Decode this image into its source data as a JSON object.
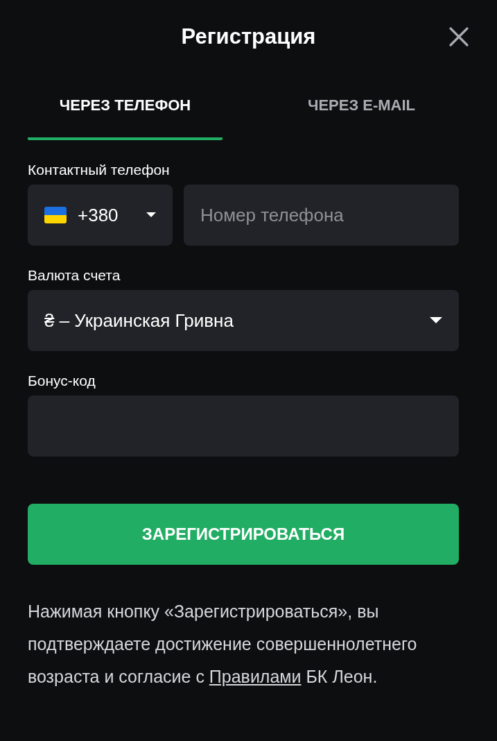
{
  "title": "Регистрация",
  "tabs": [
    {
      "label": "ЧЕРЕЗ ТЕЛЕФОН",
      "selected": true
    },
    {
      "label": "ЧЕРЕЗ E-MAIL",
      "selected": false
    }
  ],
  "phone": {
    "label": "Контактный телефон",
    "country_code": "+380",
    "placeholder": "Номер телефона"
  },
  "currency": {
    "label": "Валюта счета",
    "value": "₴ – Украинская Гривна"
  },
  "bonus_code": {
    "label": "Бонус-код"
  },
  "submit_button": "ЗАРЕГИСТРИРОВАТЬСЯ",
  "notice": {
    "text_before": "Нажимая кнопку «Зарегистрироваться», вы подтверждаете достижение совершеннолетнего возраста и согласие с ",
    "link": "Правилами",
    "text_after": " БК Леон."
  }
}
